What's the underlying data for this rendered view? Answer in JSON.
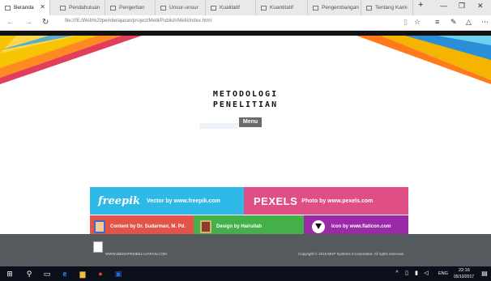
{
  "browser": {
    "tabs": [
      {
        "label": "Beranda",
        "active": true
      },
      {
        "label": "Pendahuluan"
      },
      {
        "label": "Pengertian"
      },
      {
        "label": "Unsur-unsur"
      },
      {
        "label": "Kualitatif"
      },
      {
        "label": "Kuantitatif"
      },
      {
        "label": "Pengembangan"
      },
      {
        "label": "Tentang Kami"
      }
    ],
    "new_tab": "+",
    "url": "file:///E:/Web%20pembelajaran/project/Metli/Publish/Metli/index.html"
  },
  "page": {
    "title_line1": "METODOLOGI",
    "title_line2": "PENELITIAN",
    "menu_label": "Menu"
  },
  "credits": {
    "freepik_brand": "freepik",
    "freepik_text": "Vector by www.freepik.com",
    "pexels_brand": "PEXELS",
    "pexels_text": "Photo by www.pexels.com",
    "author_text": "Content by Dr. Sudarman, M. Pd.",
    "designer_text": "Design by Hairullah",
    "icons_text": "Icon by www.flaticon.com"
  },
  "footer": {
    "site": "WWW.MEDIAPEMBELAJARAN.COM",
    "copyright": "Copyright © 2016 MHP Systems Incorporated. All rights reserved."
  },
  "taskbar": {
    "language": "ENG",
    "time": "22:16",
    "date": "05/10/2017"
  },
  "colors": {
    "freepik": "#2fb9e8",
    "pexels": "#e04e86",
    "author": "#e3534a",
    "designer": "#43b04a",
    "icons": "#9a2aa8",
    "footer": "#555a5f"
  }
}
